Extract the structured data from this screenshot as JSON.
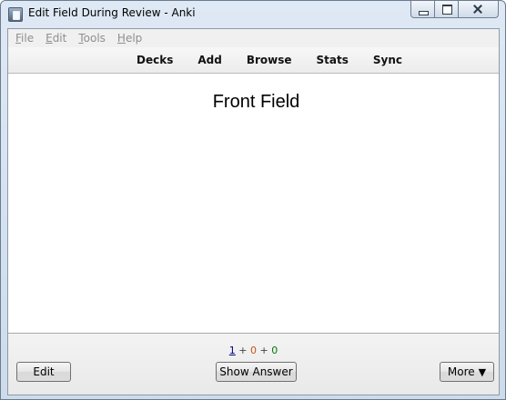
{
  "window": {
    "title": "Edit Field During Review - Anki"
  },
  "menubar": {
    "items": [
      {
        "label": "File",
        "mnemonic": "F",
        "rest": "ile"
      },
      {
        "label": "Edit",
        "mnemonic": "E",
        "rest": "dit"
      },
      {
        "label": "Tools",
        "mnemonic": "T",
        "rest": "ools"
      },
      {
        "label": "Help",
        "mnemonic": "H",
        "rest": "elp"
      }
    ]
  },
  "toolbar": {
    "links": [
      "Decks",
      "Add",
      "Browse",
      "Stats",
      "Sync"
    ]
  },
  "card": {
    "front_text": "Front Field"
  },
  "bottombar": {
    "counts": {
      "new": "1",
      "learning": "0",
      "review": "0",
      "separator": "+"
    },
    "edit_label": "Edit",
    "show_answer_label": "Show Answer",
    "more_label": "More",
    "more_arrow": "▼"
  },
  "colors": {
    "new_count": "#000080",
    "learning_count": "#c35617",
    "review_count": "#007700"
  }
}
